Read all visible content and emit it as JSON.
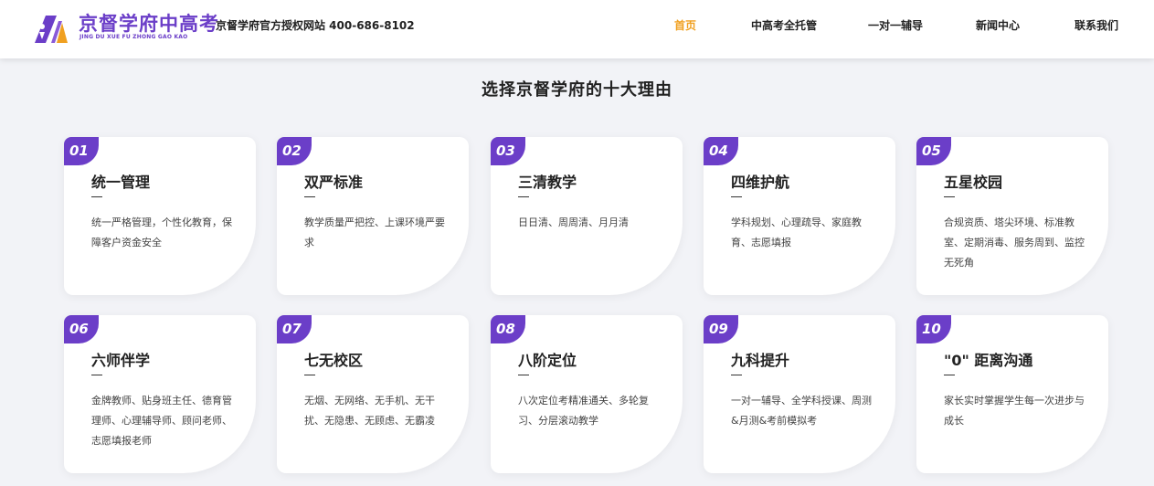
{
  "header": {
    "brand_cn": "京督学府中高考",
    "brand_en": "JING DU XUE FU ZHONG GAO KAO",
    "tagline": "京督学府官方授权网站 400-686-8102",
    "nav": [
      "首页",
      "中高考全托管",
      "一对一辅导",
      "新闻中心",
      "联系我们"
    ]
  },
  "colors": {
    "accent": "#6b3ec8",
    "nav_active": "#f0a020",
    "background": "#f2f3f7"
  },
  "section": {
    "title": "选择京督学府的十大理由",
    "cards": [
      {
        "num": "01",
        "title": "统一管理",
        "desc": "统一严格管理，个性化教育，保障客户资金安全"
      },
      {
        "num": "02",
        "title": "双严标准",
        "desc": "教学质量严把控、上课环境严要求"
      },
      {
        "num": "03",
        "title": "三清教学",
        "desc": "日日清、周周清、月月清"
      },
      {
        "num": "04",
        "title": "四维护航",
        "desc": "学科规划、心理疏导、家庭教育、志愿填报"
      },
      {
        "num": "05",
        "title": "五星校园",
        "desc": "合规资质、塔尖环境、标准教室、定期消毒、服务周到、监控无死角"
      },
      {
        "num": "06",
        "title": "六师伴学",
        "desc": "金牌教师、贴身班主任、德育管理师、心理辅导师、顾问老师、志愿填报老师"
      },
      {
        "num": "07",
        "title": "七无校区",
        "desc": "无烟、无网络、无手机、无干扰、无隐患、无顾虑、无霸凌"
      },
      {
        "num": "08",
        "title": "八阶定位",
        "desc": "八次定位考精准通关、多轮复习、分层滚动教学"
      },
      {
        "num": "09",
        "title": "九科提升",
        "desc": "一对一辅导、全学科授课、周测&月测&考前模拟考"
      },
      {
        "num": "10",
        "title": "\"0\" 距离沟通",
        "desc": "家长实时掌握学生每一次进步与成长"
      }
    ]
  }
}
